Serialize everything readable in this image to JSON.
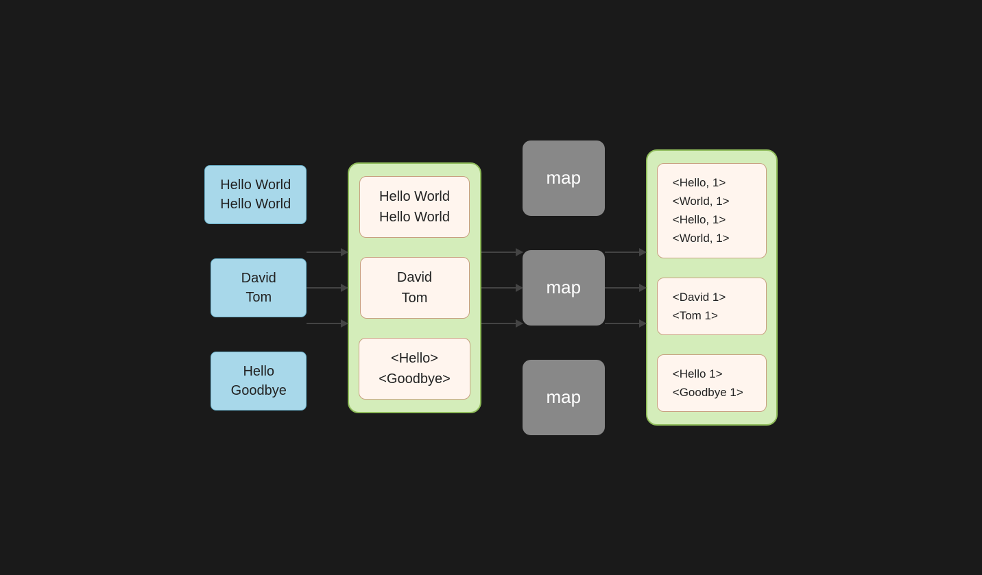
{
  "inputs": [
    {
      "id": "input-1",
      "line1": "Hello World",
      "line2": "Hello World"
    },
    {
      "id": "input-2",
      "line1": "David",
      "line2": "Tom"
    },
    {
      "id": "input-3",
      "line1": "Hello",
      "line2": "Goodbye"
    }
  ],
  "green_inputs": [
    {
      "id": "green-input-1",
      "line1": "Hello World",
      "line2": "Hello World"
    },
    {
      "id": "green-input-2",
      "line1": "David",
      "line2": "Tom"
    },
    {
      "id": "green-input-3",
      "line1": "<Hello>",
      "line2": "<Goodbye>"
    }
  ],
  "map_labels": [
    "map",
    "map",
    "map"
  ],
  "outputs": [
    {
      "id": "output-1",
      "lines": [
        "<Hello, 1>",
        "<World, 1>",
        "<Hello, 1>",
        "<World, 1>"
      ]
    },
    {
      "id": "output-2",
      "lines": [
        "<David 1>",
        "<Tom 1>"
      ]
    },
    {
      "id": "output-3",
      "lines": [
        "<Hello 1>",
        "<Goodbye 1>"
      ]
    }
  ]
}
